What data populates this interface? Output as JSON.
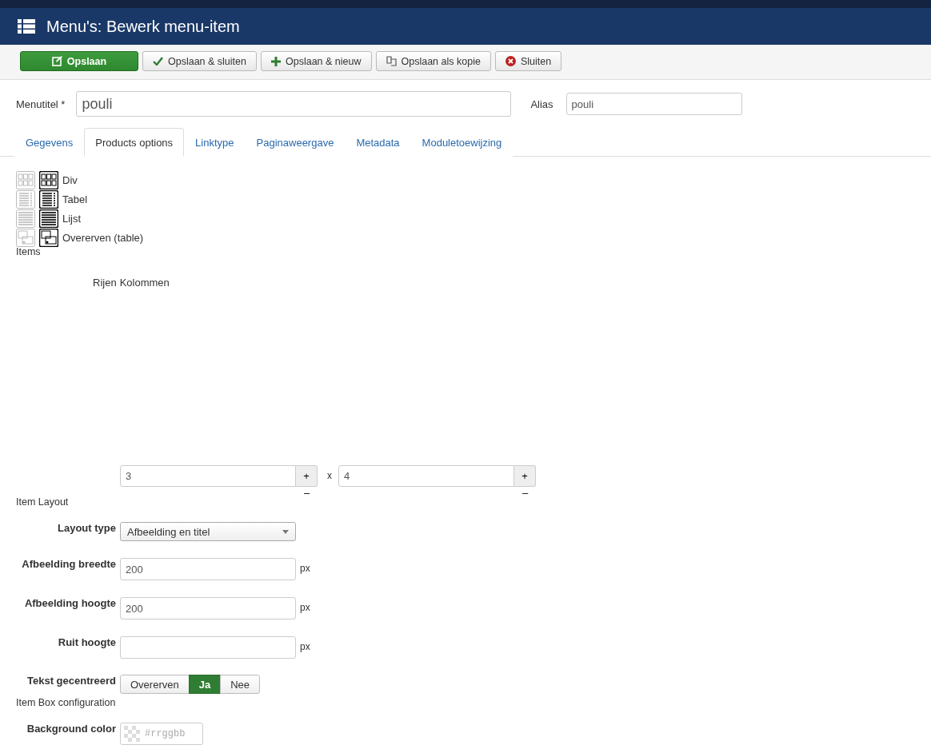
{
  "header": {
    "title": "Menu's: Bewerk menu-item"
  },
  "toolbar": [
    {
      "label": "Opslaan",
      "kind": "save"
    },
    {
      "label": "Opslaan & sluiten",
      "kind": "save-close"
    },
    {
      "label": "Opslaan & nieuw",
      "kind": "save-new"
    },
    {
      "label": "Opslaan als kopie",
      "kind": "copy"
    },
    {
      "label": "Sluiten",
      "kind": "close"
    }
  ],
  "title_field": {
    "label": "Menutitel *",
    "value": "pouli"
  },
  "alias_field": {
    "label": "Alias",
    "value": "pouli"
  },
  "tabs": [
    {
      "label": "Gegevens",
      "selected": false
    },
    {
      "label": "Products options",
      "selected": true
    },
    {
      "label": "Linktype",
      "selected": false
    },
    {
      "label": "Paginaweergave",
      "selected": false
    },
    {
      "label": "Metadata",
      "selected": false
    },
    {
      "label": "Moduletoewijzing",
      "selected": false
    }
  ],
  "layout_options": [
    {
      "label": "Div",
      "kind": "grid"
    },
    {
      "label": "Tabel",
      "kind": "table"
    },
    {
      "label": "Lijst",
      "kind": "list"
    },
    {
      "label": "Overerven (table)",
      "kind": "inherit"
    }
  ],
  "items_heading": "Items",
  "grid": {
    "rows_label": "Rijen",
    "cols_label": "Kolommen",
    "separator": "x",
    "spinners": [
      {
        "value": "3",
        "plus": "+",
        "minus": "–"
      },
      {
        "value": "4",
        "plus": "+",
        "minus": "–"
      }
    ]
  },
  "item_layout_heading": "Item Layout",
  "layout_type": {
    "label": "Layout type",
    "value": "Afbeelding en titel"
  },
  "size_fields": [
    {
      "label": "Afbeelding breedte",
      "value": "200",
      "unit": "px"
    },
    {
      "label": "Afbeelding hoogte",
      "value": "200",
      "unit": "px"
    },
    {
      "label": "Ruit hoogte",
      "unit": "px"
    }
  ],
  "text_centered": {
    "label": "Tekst gecentreerd",
    "options": [
      {
        "label": "Overerven",
        "selected": false
      },
      {
        "label": "Ja",
        "selected": true
      },
      {
        "label": "Nee",
        "selected": false
      }
    ]
  },
  "item_box_heading": "Item Box configuration",
  "background_color": {
    "label": "Background color",
    "placeholder": "#rrggbb"
  }
}
